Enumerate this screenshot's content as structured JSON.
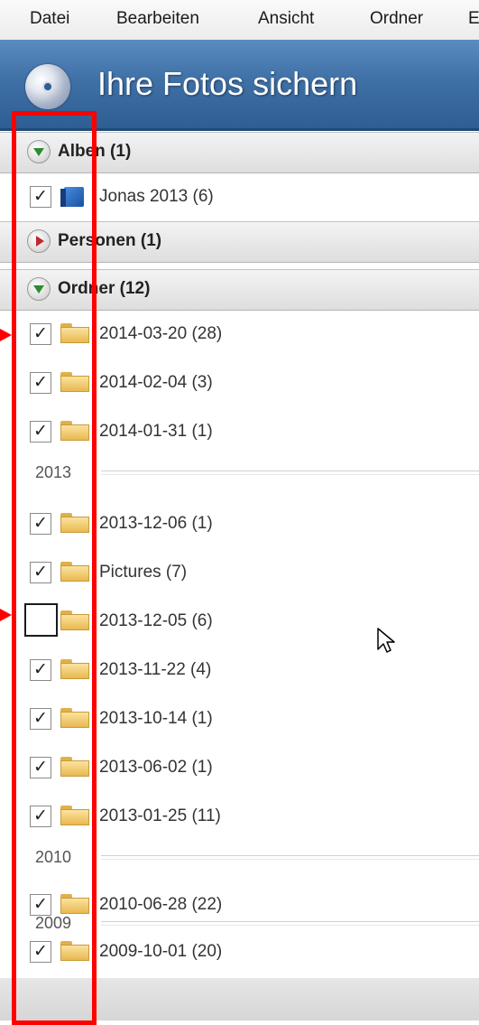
{
  "menubar": {
    "items": [
      "Datei",
      "Bearbeiten",
      "Ansicht",
      "Ordner",
      "E"
    ]
  },
  "app": {
    "title": "Ihre Fotos sichern",
    "icon": "disc-icon"
  },
  "groups": {
    "albums": {
      "label": "Alben (1)",
      "expanded": true,
      "items": [
        {
          "label": "Jonas 2013 (6)",
          "checked": true
        }
      ]
    },
    "persons": {
      "label": "Personen (1)",
      "expanded": false
    },
    "folders": {
      "label": "Ordner (12)",
      "expanded": true,
      "items": [
        {
          "label": "2014-03-20 (28)",
          "checked": true
        },
        {
          "label": "2014-02-04 (3)",
          "checked": true
        },
        {
          "label": "2014-01-31 (1)",
          "checked": true
        },
        {
          "label": "2013-12-06 (1)",
          "checked": true
        },
        {
          "label": "Pictures (7)",
          "checked": true
        },
        {
          "label": "2013-12-05 (6)",
          "checked": false
        },
        {
          "label": "2013-11-22 (4)",
          "checked": true
        },
        {
          "label": "2013-10-14 (1)",
          "checked": true
        },
        {
          "label": "2013-06-02 (1)",
          "checked": true
        },
        {
          "label": "2013-01-25 (11)",
          "checked": true
        },
        {
          "label": "2010-06-28 (22)",
          "checked": true
        },
        {
          "label": "2009-10-01 (20)",
          "checked": true
        }
      ],
      "year_separators": [
        "2013",
        "2010",
        "2009"
      ]
    }
  },
  "checkmark_glyph": "✓",
  "colors": {
    "title_bar": "#3f70a6",
    "annotation_red": "#ff0000"
  }
}
